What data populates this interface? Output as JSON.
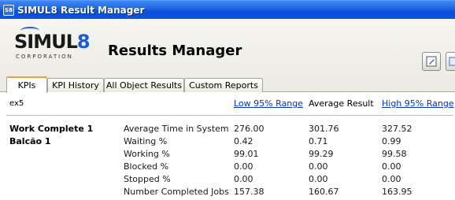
{
  "window": {
    "title": "SIMUL8 Result Manager",
    "app_icon_text": "S8"
  },
  "header": {
    "logo_main_a": "SIMUL",
    "logo_main_b": "8",
    "logo_sub": "CORPORATION",
    "page_title": "Results Manager",
    "button1_icon": "edit-icon",
    "button2_icon": "copy-icon"
  },
  "tabs": [
    {
      "label": "KPIs",
      "active": true
    },
    {
      "label": "KPI History",
      "active": false
    },
    {
      "label": "All Object Results",
      "active": false
    },
    {
      "label": "Custom Reports",
      "active": false
    }
  ],
  "results": {
    "scenario": "ex5",
    "columns": {
      "low": "Low 95% Range",
      "avg": "Average Result",
      "high": "High 95% Range"
    },
    "rows": [
      {
        "object": "Work Complete 1",
        "metric": "Average Time in System",
        "low": "276.00",
        "avg": "301.76",
        "high": "327.52"
      },
      {
        "object": "Balcão 1",
        "metric": "Waiting %",
        "low": "0.42",
        "avg": "0.71",
        "high": "0.99"
      },
      {
        "object": "",
        "metric": "Working %",
        "low": "99.01",
        "avg": "99.29",
        "high": "99.58"
      },
      {
        "object": "",
        "metric": "Blocked %",
        "low": "0.00",
        "avg": "0.00",
        "high": "0.00"
      },
      {
        "object": "",
        "metric": "Stopped %",
        "low": "0.00",
        "avg": "0.00",
        "high": "0.00"
      },
      {
        "object": "",
        "metric": "Number Completed Jobs",
        "low": "157.38",
        "avg": "160.67",
        "high": "163.95"
      }
    ]
  }
}
